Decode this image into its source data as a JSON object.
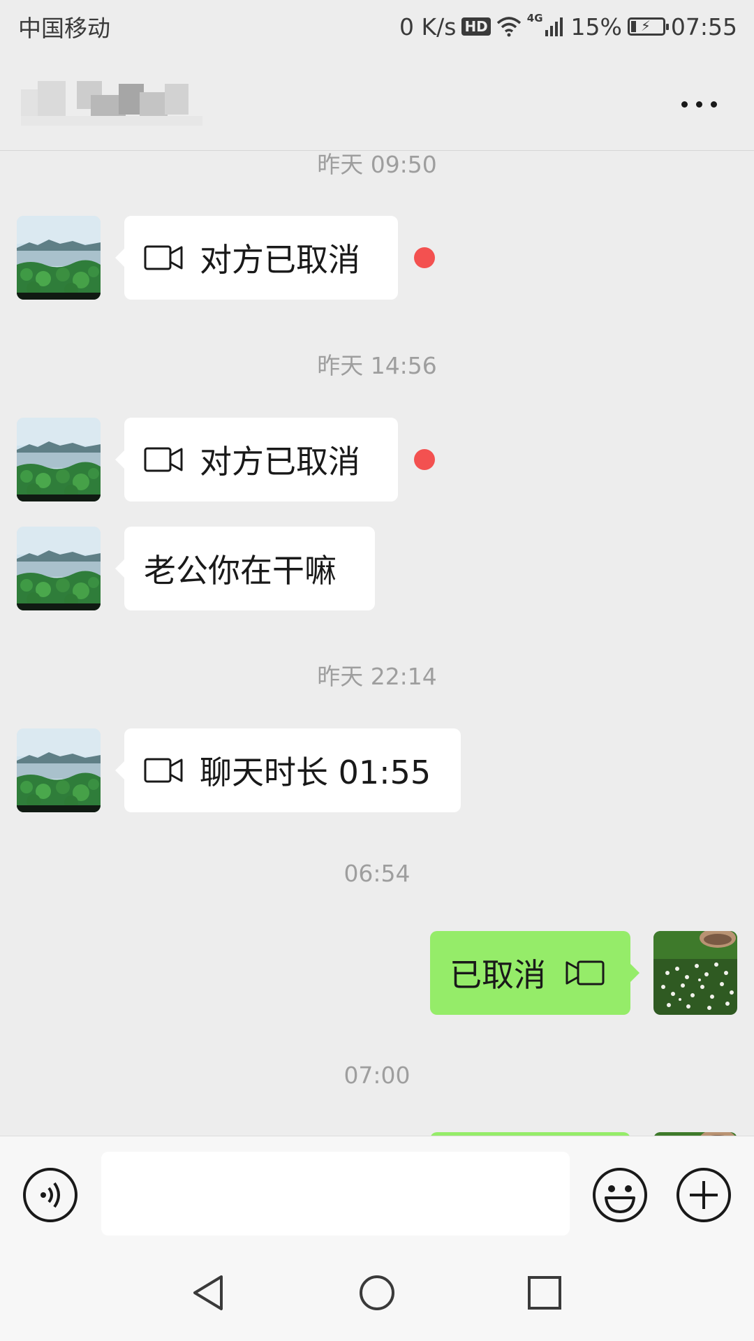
{
  "status_bar": {
    "carrier": "中国移动",
    "net_speed": "0 K/s",
    "hd": "HD",
    "network": "4G",
    "battery": "15%",
    "time": "07:55"
  },
  "header": {
    "contact_name_obscured": true,
    "more_icon": "more-dots-icon"
  },
  "messages": [
    {
      "type": "timestamp",
      "text": "昨天 09:50"
    },
    {
      "type": "video_call",
      "from": "other",
      "text": "对方已取消",
      "unread_dot": true
    },
    {
      "type": "timestamp",
      "text": "昨天 14:56"
    },
    {
      "type": "video_call",
      "from": "other",
      "text": "对方已取消",
      "unread_dot": true
    },
    {
      "type": "text",
      "from": "other",
      "text": "老公你在干嘛"
    },
    {
      "type": "timestamp",
      "text": "昨天 22:14"
    },
    {
      "type": "video_call",
      "from": "other",
      "text": "聊天时长 01:55"
    },
    {
      "type": "timestamp",
      "text": "06:54"
    },
    {
      "type": "video_call",
      "from": "me",
      "text": "已取消"
    },
    {
      "type": "timestamp",
      "text": "07:00"
    }
  ],
  "input_bar": {
    "voice_icon": "voice-icon",
    "input_value": "",
    "emoji_icon": "emoji-icon",
    "plus_icon": "plus-icon"
  },
  "colors": {
    "background": "#ededed",
    "incoming_bubble": "#ffffff",
    "outgoing_bubble": "#95ec69",
    "unread_dot": "#f35150",
    "timestamp": "#9e9e9e"
  }
}
